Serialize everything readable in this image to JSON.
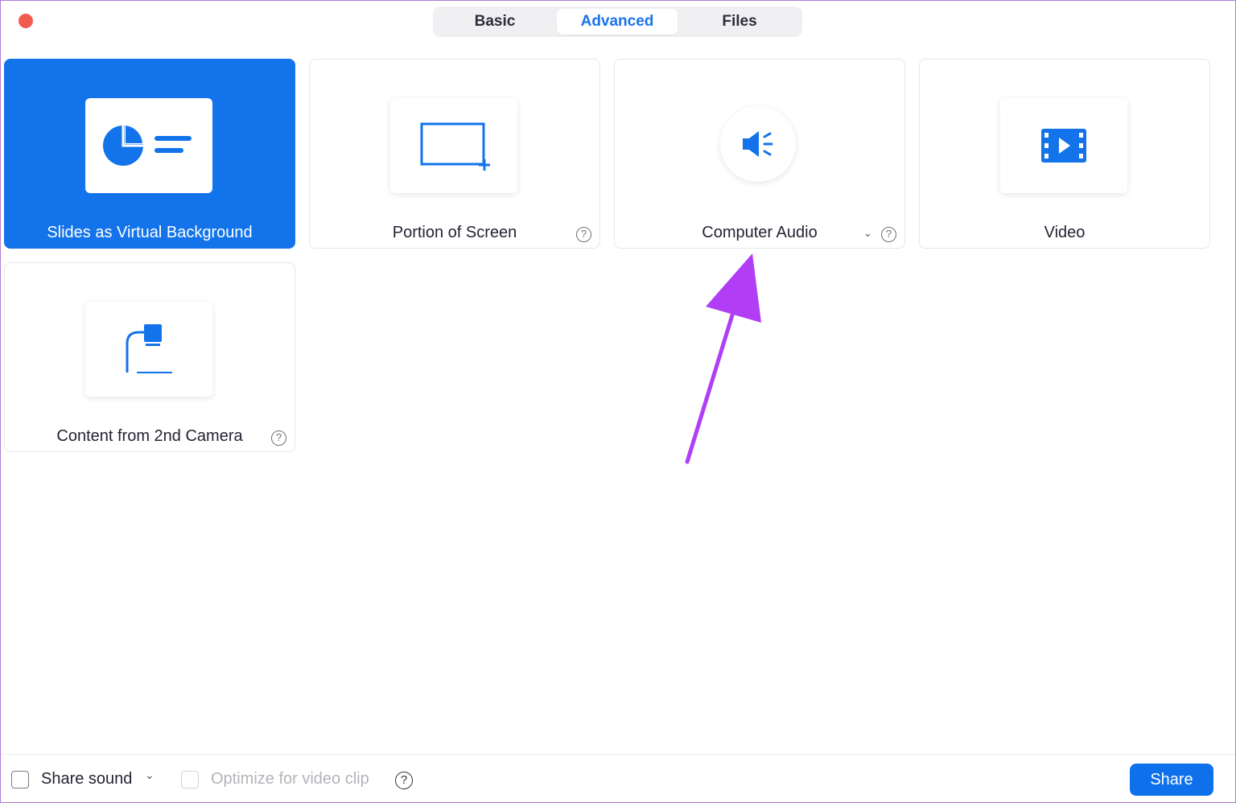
{
  "window": {
    "tabs": [
      {
        "label": "Basic"
      },
      {
        "label": "Advanced"
      },
      {
        "label": "Files"
      }
    ],
    "active_tab": "Advanced"
  },
  "options": [
    {
      "label": "Slides as Virtual Background",
      "icon": "slides-icon",
      "selected": true
    },
    {
      "label": "Portion of Screen",
      "icon": "portion-screen-icon",
      "help": "?"
    },
    {
      "label": "Computer Audio",
      "icon": "speaker-icon",
      "dropdown_icon": "chevron-down-icon",
      "help": "?"
    },
    {
      "label": "Video",
      "icon": "video-file-icon"
    },
    {
      "label": "Content from 2nd Camera",
      "icon": "document-camera-icon",
      "help": "?"
    }
  ],
  "footer": {
    "share_sound_label": "Share sound",
    "share_sound_chevron": "⌄",
    "optimize_label": "Optimize for video clip",
    "optimize_help": "?",
    "share_button": "Share"
  },
  "colors": {
    "accent": "#1273ea",
    "annotation_arrow": "#b13ef5",
    "close_button": "#f25b4f"
  }
}
